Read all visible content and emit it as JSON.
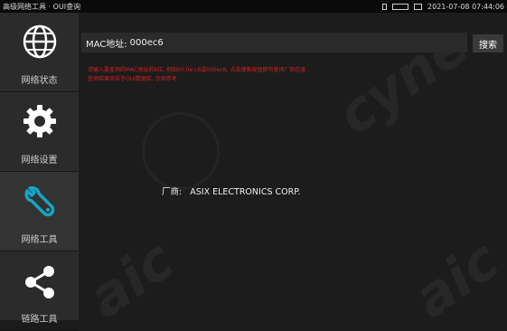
{
  "titlebar": {
    "title": "高级网络工具 · OUI查询",
    "clock": "2021-07-08 07:44:06"
  },
  "sidebar": {
    "items": [
      {
        "label": "网络状态",
        "icon": "globe-icon"
      },
      {
        "label": "网络设置",
        "icon": "gear-icon"
      },
      {
        "label": "网络工具",
        "icon": "wrench-icon"
      },
      {
        "label": "链路工具",
        "icon": "share-icon"
      }
    ]
  },
  "main": {
    "mac_label": "MAC地址:",
    "mac_value": "000ec6",
    "search_label": "搜索",
    "red_line_1": "请输入要查询的MAC地址前6位, 例如00:0e:c6或000ec6, 点击搜索按钮即可查询厂商信息",
    "red_line_2": "查询结果来自于OUI数据库, 仅供参考",
    "vendor_label": "厂商:",
    "vendor_value": "ASIX ELECTRONICS CORP."
  },
  "colors": {
    "background": "#1c1c1c",
    "sidebar": "#2b2b2b",
    "hint_red": "#d22020",
    "tool_active": "#12a6c7"
  }
}
